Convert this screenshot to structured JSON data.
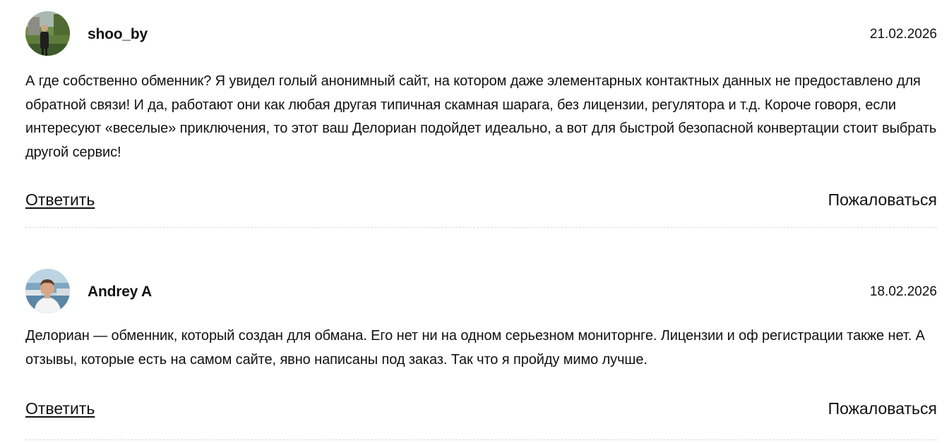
{
  "comments": [
    {
      "author": "shoo_by",
      "date": "21.02.2026",
      "text": "А где собственно обменник? Я увидел голый анонимный сайт, на котором даже элементарных контактных данных не предоставлено для обратной связи! И да, работают они как любая другая типичная скамная шарага, без лицензии, регулятора и т.д. Короче говоря, если интересуют «веселые» приключения, то этот ваш Делориан подойдет идеально, а вот для быстрой безопасной конвертации стоит выбрать другой сервис!",
      "reply_label": "Ответить",
      "report_label": "Пожаловаться"
    },
    {
      "author": "Andrey A",
      "date": "18.02.2026",
      "text": "Делориан — обменник, который создан для обмана. Его нет ни на одном серьезном мониторнге. Лицензии и оф регистрации также нет. А отзывы, которые есть на самом сайте, явно написаны под заказ. Так что я пройду мимо лучше.",
      "reply_label": "Ответить",
      "report_label": "Пожаловаться"
    }
  ]
}
